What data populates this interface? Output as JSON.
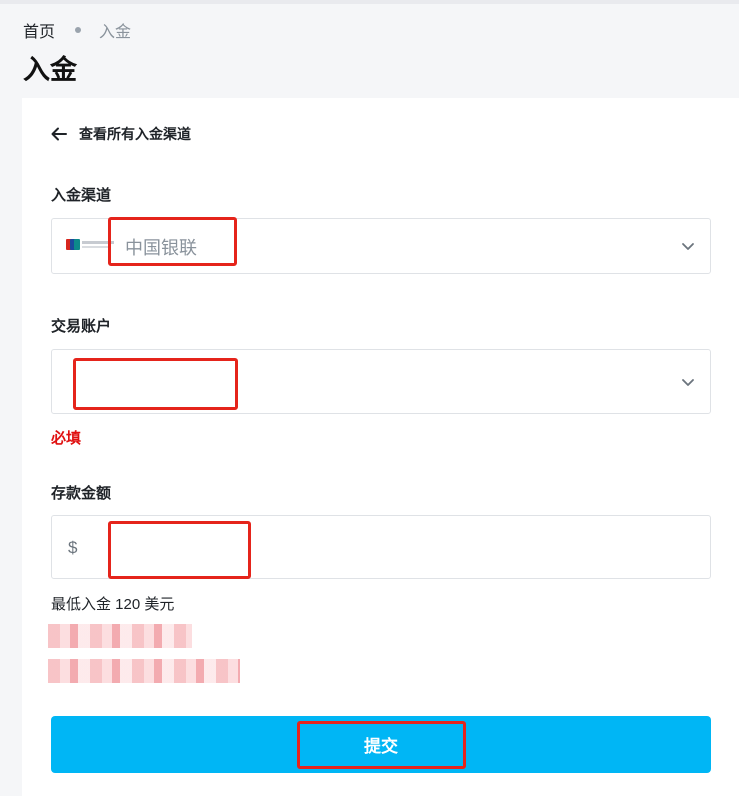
{
  "breadcrumb": {
    "home": "首页",
    "current": "入金"
  },
  "page": {
    "title": "入金"
  },
  "back_link": {
    "label": "查看所有入金渠道"
  },
  "channel": {
    "label": "入金渠道",
    "value": "中国银联",
    "icon": "unionpay-icon"
  },
  "account": {
    "label": "交易账户",
    "value": "",
    "error": "必填"
  },
  "amount": {
    "label": "存款金额",
    "currency": "$",
    "value": "",
    "min_note": "最低入金 120 美元"
  },
  "submit": {
    "label": "提交"
  },
  "colors": {
    "accent": "#00b6f5",
    "error": "#e01010",
    "highlight_box": "#e5241b"
  }
}
